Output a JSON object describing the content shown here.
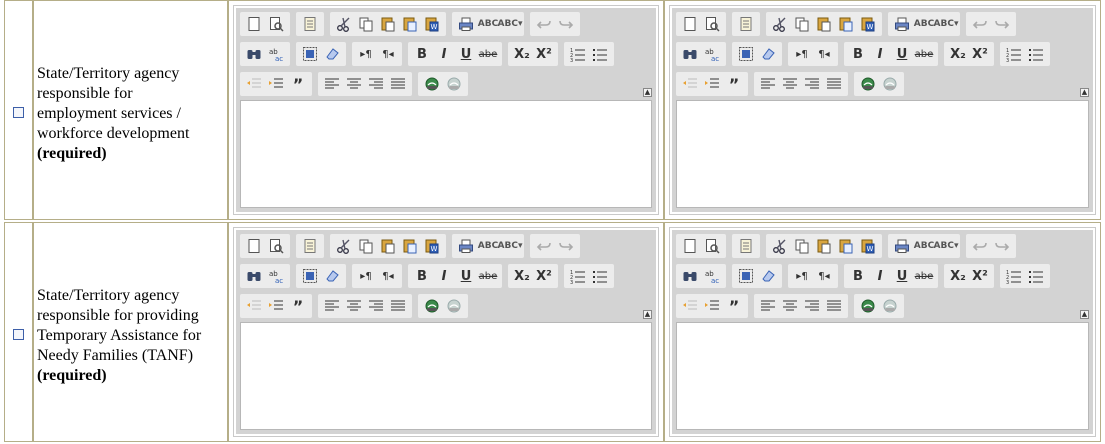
{
  "rows": [
    {
      "label_lines": [
        "State/Territory agency",
        "responsible for",
        "employment services /",
        "workforce development"
      ],
      "required": "(required)",
      "checked": false
    },
    {
      "label_lines": [
        "State/Territory agency",
        "responsible for providing",
        "Temporary Assistance for",
        "Needy Families (TANF)"
      ],
      "required": "(required)",
      "checked": false
    }
  ],
  "toolbar": {
    "row1": [
      [
        "new-page",
        "preview"
      ],
      [
        "templates"
      ],
      [
        "cut",
        "copy",
        "paste",
        "paste-text",
        "paste-word"
      ],
      [
        "print",
        "spell-check",
        "scayt"
      ],
      [
        "undo",
        "redo"
      ]
    ],
    "row2": [
      [
        "find",
        "replace"
      ],
      [
        "select-all",
        "remove-format"
      ],
      [
        "ltr",
        "rtl"
      ],
      [
        "bold",
        "italic",
        "underline",
        "strike"
      ],
      [
        "subscript",
        "superscript"
      ],
      [
        "numbered-list",
        "bulleted-list"
      ]
    ],
    "row3": [
      [
        "outdent",
        "indent",
        "blockquote"
      ],
      [
        "justify-left",
        "justify-center",
        "justify-right",
        "justify-block"
      ],
      [
        "link",
        "unlink"
      ]
    ],
    "labels": {
      "bold": "B",
      "italic": "I",
      "underline": "U",
      "strike": "abe",
      "subscript": "X₂",
      "superscript": "X²",
      "spell_check": "ABC",
      "scayt": "ABC▾",
      "blockquote": "”",
      "ltr": "▸¶",
      "rtl": "¶◂"
    },
    "collapse_symbol": "▲"
  }
}
